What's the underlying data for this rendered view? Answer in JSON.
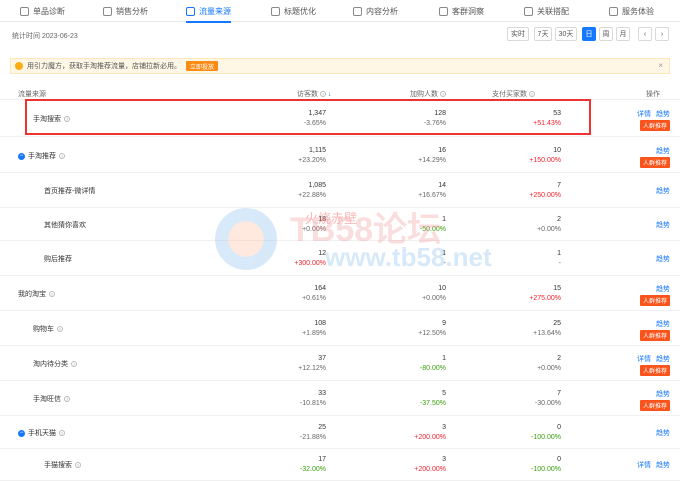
{
  "tabs": [
    {
      "label": "单品诊断",
      "icon": "grid-icon"
    },
    {
      "label": "销售分析",
      "icon": "chart-icon"
    },
    {
      "label": "流量来源",
      "icon": "trend-icon",
      "active": true
    },
    {
      "label": "标题优化",
      "icon": "wave-icon"
    },
    {
      "label": "内容分析",
      "icon": "doc-icon"
    },
    {
      "label": "客群洞察",
      "icon": "people-icon"
    },
    {
      "label": "关联搭配",
      "icon": "link-icon"
    },
    {
      "label": "服务体验",
      "icon": "headset-icon"
    }
  ],
  "stat_time": "统计时间 2023-06-23",
  "time_buttons": [
    "实时",
    "7天",
    "30天",
    "日",
    "周",
    "月"
  ],
  "time_active": "日",
  "notice": {
    "text": "用引力魔方，获取手淘推荐流量，店铺拉新必用。",
    "button": "立即投放"
  },
  "headers": {
    "source": "流量来源",
    "visitors": "访客数",
    "cart": "加购人数",
    "buyers": "支付买家数",
    "ops": "操作"
  },
  "rows": [
    {
      "name": "手淘搜索",
      "q": true,
      "v1": "1,347",
      "c1": "-3.65%",
      "d1": "neutral",
      "v2": "128",
      "c2": "-3.76%",
      "d2": "neutral",
      "v3": "53",
      "c3": "+51.43%",
      "d3": "up",
      "links": [
        "详情",
        "趋势"
      ],
      "tag": "人群推荐"
    },
    {
      "name": "手淘推荐",
      "q": true,
      "exp": true,
      "v1": "1,115",
      "c1": "+23.20%",
      "d1": "neutral",
      "v2": "16",
      "c2": "+14.29%",
      "d2": "neutral",
      "v3": "10",
      "c3": "+150.00%",
      "d3": "up",
      "links": [
        "趋势"
      ],
      "tag": "人群推荐"
    },
    {
      "name": "首页推荐-微详情",
      "q": false,
      "v1": "1,085",
      "c1": "+22.88%",
      "d1": "neutral",
      "v2": "14",
      "c2": "+16.67%",
      "d2": "neutral",
      "v3": "7",
      "c3": "+250.00%",
      "d3": "up",
      "links": [
        "趋势"
      ]
    },
    {
      "name": "其他猜你喜欢",
      "q": false,
      "v1": "18",
      "c1": "+0.00%",
      "d1": "neutral",
      "v2": "1",
      "c2": "-50.00%",
      "d2": "dn",
      "v3": "2",
      "c3": "+0.00%",
      "d3": "neutral",
      "links": [
        "趋势"
      ]
    },
    {
      "name": "购后推荐",
      "q": false,
      "v1": "12",
      "c1": "+300.00%",
      "d1": "up",
      "v2": "1",
      "c2": "-",
      "d2": "neutral",
      "v3": "1",
      "c3": "-",
      "d3": "neutral",
      "links": [
        "趋势"
      ]
    },
    {
      "name": "我的淘宝",
      "q": true,
      "v1": "164",
      "c1": "+0.61%",
      "d1": "neutral",
      "v2": "10",
      "c2": "+0.00%",
      "d2": "neutral",
      "v3": "15",
      "c3": "+275.00%",
      "d3": "up",
      "links": [
        "趋势"
      ],
      "tag": "人群推荐"
    },
    {
      "name": "购物车",
      "q": true,
      "v1": "108",
      "c1": "+1.89%",
      "d1": "neutral",
      "v2": "9",
      "c2": "+12.50%",
      "d2": "neutral",
      "v3": "25",
      "c3": "+13.64%",
      "d3": "neutral",
      "links": [
        "趋势"
      ],
      "tag": "人群推荐"
    },
    {
      "name": "淘内待分类",
      "q": true,
      "v1": "37",
      "c1": "+12.12%",
      "d1": "neutral",
      "v2": "1",
      "c2": "-80.00%",
      "d2": "dn",
      "v3": "2",
      "c3": "+0.00%",
      "d3": "neutral",
      "links": [
        "详情",
        "趋势"
      ],
      "tag": "人群推荐"
    },
    {
      "name": "手淘旺信",
      "q": true,
      "v1": "33",
      "c1": "-10.81%",
      "d1": "neutral",
      "v2": "5",
      "c2": "-37.50%",
      "d2": "dn",
      "v3": "7",
      "c3": "-30.00%",
      "d3": "neutral",
      "links": [
        "趋势"
      ],
      "tag": "人群推荐"
    },
    {
      "name": "手机天猫",
      "q": true,
      "exp": true,
      "v1": "25",
      "c1": "-21.88%",
      "d1": "neutral",
      "v2": "3",
      "c2": "+200.00%",
      "d2": "up",
      "v3": "0",
      "c3": "-100.00%",
      "d3": "dn",
      "links": [
        "趋势"
      ]
    },
    {
      "name": "手猫搜索",
      "q": true,
      "v1": "17",
      "c1": "-32.00%",
      "d1": "dn",
      "v2": "3",
      "c2": "+200.00%",
      "d2": "up",
      "v3": "0",
      "c3": "-100.00%",
      "d3": "dn",
      "links": [
        "详情",
        "趋势"
      ]
    }
  ],
  "watermark": {
    "line1": "TB58论坛",
    "line2": "www.tb58.net",
    "line3": "火烧赤壁"
  }
}
